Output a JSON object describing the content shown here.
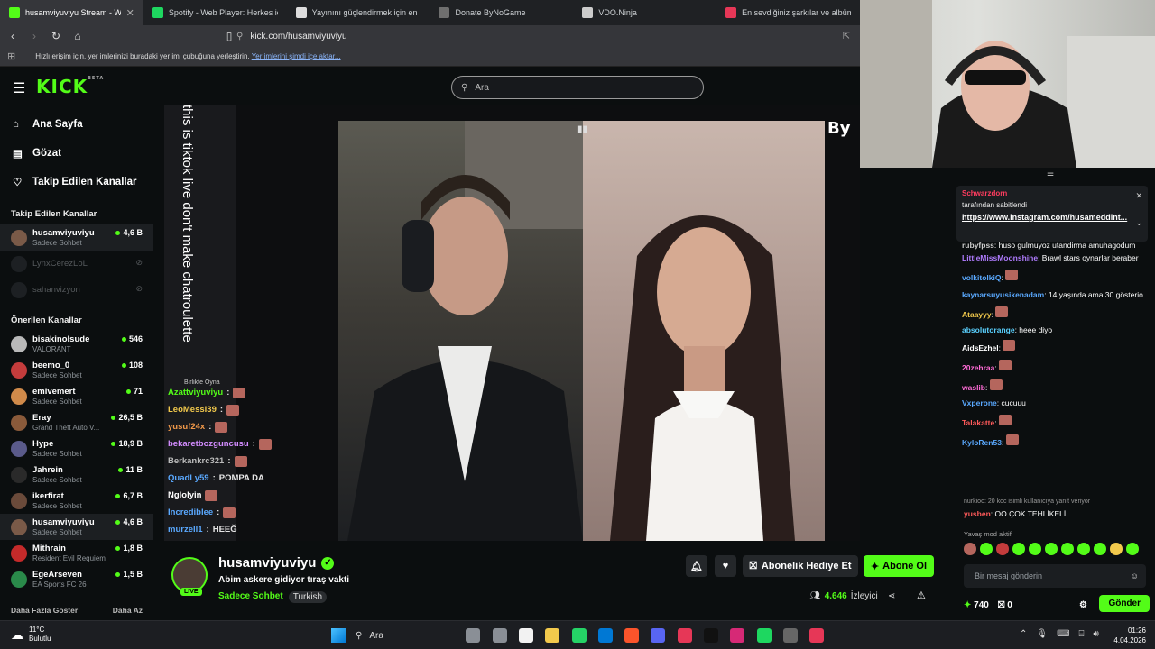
{
  "browser": {
    "tabs": [
      {
        "title": "husamviyuviyu Stream - Watch L",
        "color": "#53fc18",
        "active": true
      },
      {
        "title": "Spotify - Web Player: Herkes için mü",
        "color": "#1ed760",
        "active": false
      },
      {
        "title": "Yayınını güçlendirmek için en iyi yazı",
        "color": "#dddddd",
        "active": false
      },
      {
        "title": "Donate ByNoGame",
        "color": "#6f6f6f",
        "active": false
      },
      {
        "title": "VDO.Ninja",
        "color": "#cccccc",
        "active": false
      },
      {
        "title": "En sevdiğiniz şarkılar ve albümle",
        "color": "#e63757",
        "active": false
      }
    ],
    "url": "kick.com/husamviyuviyu",
    "bookmarks_text": "Hızlı erişim için, yer imlerinizi buradaki yer imi çubuğuna yerleştirin.",
    "bookmarks_link": "Yer imlerini şimdi içe aktar..."
  },
  "site": {
    "logo": "KICK",
    "logo_beta": "BETA",
    "search_placeholder": "Ara"
  },
  "sidebar": {
    "nav": [
      {
        "label": "Ana Sayfa",
        "icon": "home-icon"
      },
      {
        "label": "Gözat",
        "icon": "browse-icon"
      },
      {
        "label": "Takip Edilen Kanallar",
        "icon": "heart-icon"
      }
    ],
    "followed_title": "Takip Edilen Kanallar",
    "followed": [
      {
        "name": "husamviyuviyu",
        "sub": "Sadece Sohbet",
        "count": "4,6 B",
        "online": true,
        "color": "#7a5a48"
      },
      {
        "name": "LynxCerezLoL",
        "sub": "",
        "count": "",
        "online": false,
        "color": "#3a3d40"
      },
      {
        "name": "sahanvizyon",
        "sub": "",
        "count": "",
        "online": false,
        "color": "#3a3d40"
      }
    ],
    "recommended_title": "Önerilen Kanallar",
    "recommended": [
      {
        "name": "bisakinolsude",
        "sub": "VALORANT",
        "count": "546",
        "color": "#b9b9b9"
      },
      {
        "name": "beemo_0",
        "sub": "Sadece Sohbet",
        "count": "108",
        "color": "#c43c3c"
      },
      {
        "name": "emivemert",
        "sub": "Sadece Sohbet",
        "count": "71",
        "color": "#d08a4a"
      },
      {
        "name": "Eray",
        "sub": "Grand Theft Auto V...",
        "count": "26,5 B",
        "color": "#8a5a3a"
      },
      {
        "name": "Hype",
        "sub": "Sadece Sohbet",
        "count": "18,9 B",
        "color": "#5a5a8a"
      },
      {
        "name": "Jahrein",
        "sub": "Sadece Sohbet",
        "count": "11 B",
        "color": "#2a2a2a"
      },
      {
        "name": "ikerfirat",
        "sub": "Sadece Sohbet",
        "count": "6,7 B",
        "color": "#6a4a3a"
      },
      {
        "name": "husamviyuviyu",
        "sub": "Sadece Sohbet",
        "count": "4,6 B",
        "color": "#7a5a48"
      },
      {
        "name": "Mithrain",
        "sub": "Resident Evil Requiem",
        "count": "1,8 B",
        "color": "#c42a2a"
      },
      {
        "name": "EgeArseven",
        "sub": "EA Sports FC 26",
        "count": "1,5 B",
        "color": "#2a8a4a"
      }
    ],
    "show_more": "Daha Fazla Göster",
    "show_less": "Daha Az"
  },
  "player": {
    "vertical_text": "this is tiktok live don't make chatroulette",
    "bynogame": "By",
    "birlikte": "Birlikte Oyna",
    "overlay_chat": [
      {
        "user": "Azattviyuviyu",
        "sep": ":",
        "text": "",
        "color": "#53fc18",
        "emote": true
      },
      {
        "user": "LeoMessi39",
        "sep": ":",
        "text": "",
        "color": "#f2c94c",
        "emote": true
      },
      {
        "user": "yusuf24x",
        "sep": ":",
        "text": "",
        "color": "#f2994a",
        "emote": true
      },
      {
        "user": "bekaretbozguncusu",
        "sep": ":",
        "text": "",
        "color": "#d38cff",
        "emote": true
      },
      {
        "user": "Berkankrc321",
        "sep": ":",
        "text": "",
        "color": "#bbbbbb",
        "emote": true
      },
      {
        "user": "QuadLy59",
        "sep": ":",
        "text": "POMPA DA",
        "color": "#5aa9ff",
        "emote": false
      },
      {
        "user": "Nglolyin",
        "sep": "",
        "text": "",
        "color": "#ffffff",
        "emote": true
      },
      {
        "user": "Incrediblee",
        "sep": ":",
        "text": "",
        "color": "#5aa9ff",
        "emote": true
      },
      {
        "user": "murzell1",
        "sep": ":",
        "text": "HEEĞ",
        "color": "#5aa9ff",
        "emote": false
      }
    ]
  },
  "stream": {
    "name": "husamviyuviyu",
    "live": "LIVE",
    "title": "Abim askere gidiyor tıraş vakti",
    "category": "Sadece Sohbet",
    "tag": "Turkish",
    "gift_label": "Abonelik Hediye Et",
    "sub_label": "Abone Ol",
    "viewers": "4.646",
    "viewers_label": "İzleyici"
  },
  "chat": {
    "pinned_user": "Schwarzdorn",
    "pinned_by": "tarafından sabitlendi",
    "pinned_link": "https://www.instagram.com/husameddint...",
    "messages": [
      {
        "user": "rubyfpss",
        "color": "#cccccc",
        "text": "huso gulmuyoz utandirma amuhagodum",
        "emote": false
      },
      {
        "user": "LittleMissMoonshine",
        "color": "#b07cff",
        "text": "Brawl stars oynarlar beraber",
        "emote": false
      },
      {
        "user": "volkitolkiQ",
        "color": "#5aa9ff",
        "text": "",
        "emote": true
      },
      {
        "user": "kaynarsuyusikenadam",
        "color": "#5aa9ff",
        "text": "14 yaşında ama 30 gösterio",
        "emote": false
      },
      {
        "user": "Ataayyy",
        "color": "#f2c94c",
        "text": "",
        "emote": true
      },
      {
        "user": "absolutorange",
        "color": "#5ad1ff",
        "text": "heee diyo",
        "emote": false
      },
      {
        "user": "AidsEzhel",
        "color": "#ffffff",
        "text": "",
        "emote": true
      },
      {
        "user": "20zehraa",
        "color": "#ff6bd6",
        "text": "",
        "emote": true
      },
      {
        "user": "waslib",
        "color": "#ff6bd6",
        "text": "",
        "emote": true
      },
      {
        "user": "Vxperone",
        "color": "#5aa9ff",
        "text": "cucuuu",
        "emote": false
      },
      {
        "user": "Talakatte",
        "color": "#ff5a5a",
        "text": "",
        "emote": true
      },
      {
        "user": "KyloRen53",
        "color": "#5aa9ff",
        "text": "",
        "emote": true
      }
    ],
    "reply_note": "nurkioo: 20 koc isimli kullanıcıya yanıt veriyor",
    "last_user": "yusben",
    "last_text": "OO ÇOK TEHLİKELİ",
    "slow_mode": "Yavaş mod aktif",
    "input_placeholder": "Bir mesaj gönderin",
    "points": "740",
    "gifts": "0",
    "send_label": "Gönder"
  },
  "taskbar": {
    "temp": "11°C",
    "weather": "Bulutlu",
    "search": "Ara",
    "time": "01:26",
    "date": "4.04.2026"
  }
}
